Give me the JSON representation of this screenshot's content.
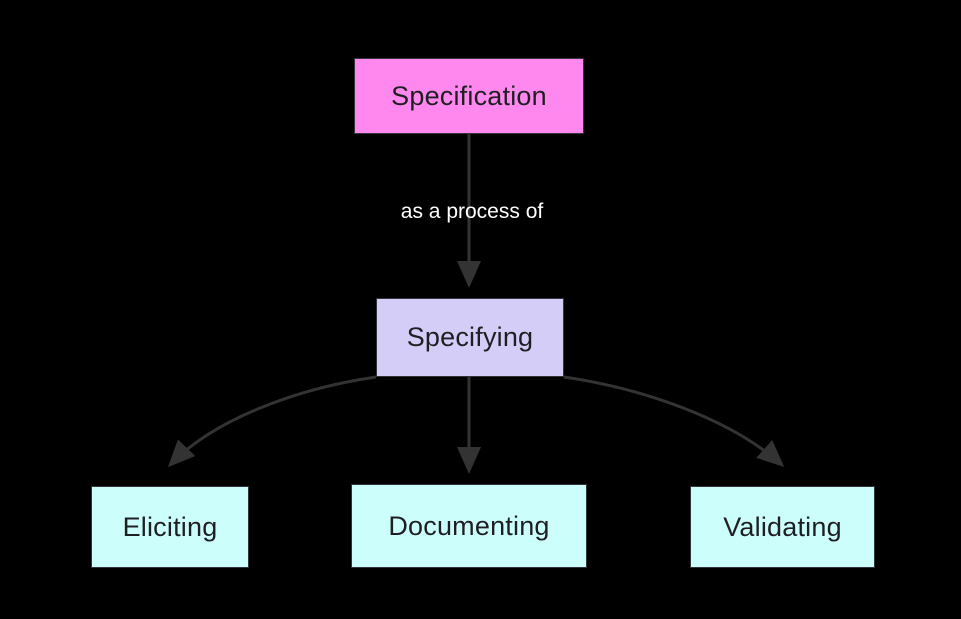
{
  "diagram": {
    "type": "flowchart",
    "direction": "top-to-bottom",
    "background_color": "#000000",
    "nodes": [
      {
        "id": "specification",
        "label": "Specification",
        "fill": "#ff88ee",
        "text_color": "#1f1f23",
        "border_color": "#33333a"
      },
      {
        "id": "specifying",
        "label": "Specifying",
        "fill": "#d3cdf8",
        "text_color": "#1f1f23",
        "border_color": "#33333a"
      },
      {
        "id": "eliciting",
        "label": "Eliciting",
        "fill": "#ccfffc",
        "text_color": "#1f1f23",
        "border_color": "#33333a"
      },
      {
        "id": "documenting",
        "label": "Documenting",
        "fill": "#ccfffc",
        "text_color": "#1f1f23",
        "border_color": "#33333a"
      },
      {
        "id": "validating",
        "label": "Validating",
        "fill": "#ccfffc",
        "text_color": "#1f1f23",
        "border_color": "#33333a"
      }
    ],
    "edges": [
      {
        "from": "specification",
        "to": "specifying",
        "label": "as a process of"
      },
      {
        "from": "specifying",
        "to": "eliciting",
        "label": ""
      },
      {
        "from": "specifying",
        "to": "documenting",
        "label": ""
      },
      {
        "from": "specifying",
        "to": "validating",
        "label": ""
      }
    ],
    "edge_color": "#333333"
  }
}
